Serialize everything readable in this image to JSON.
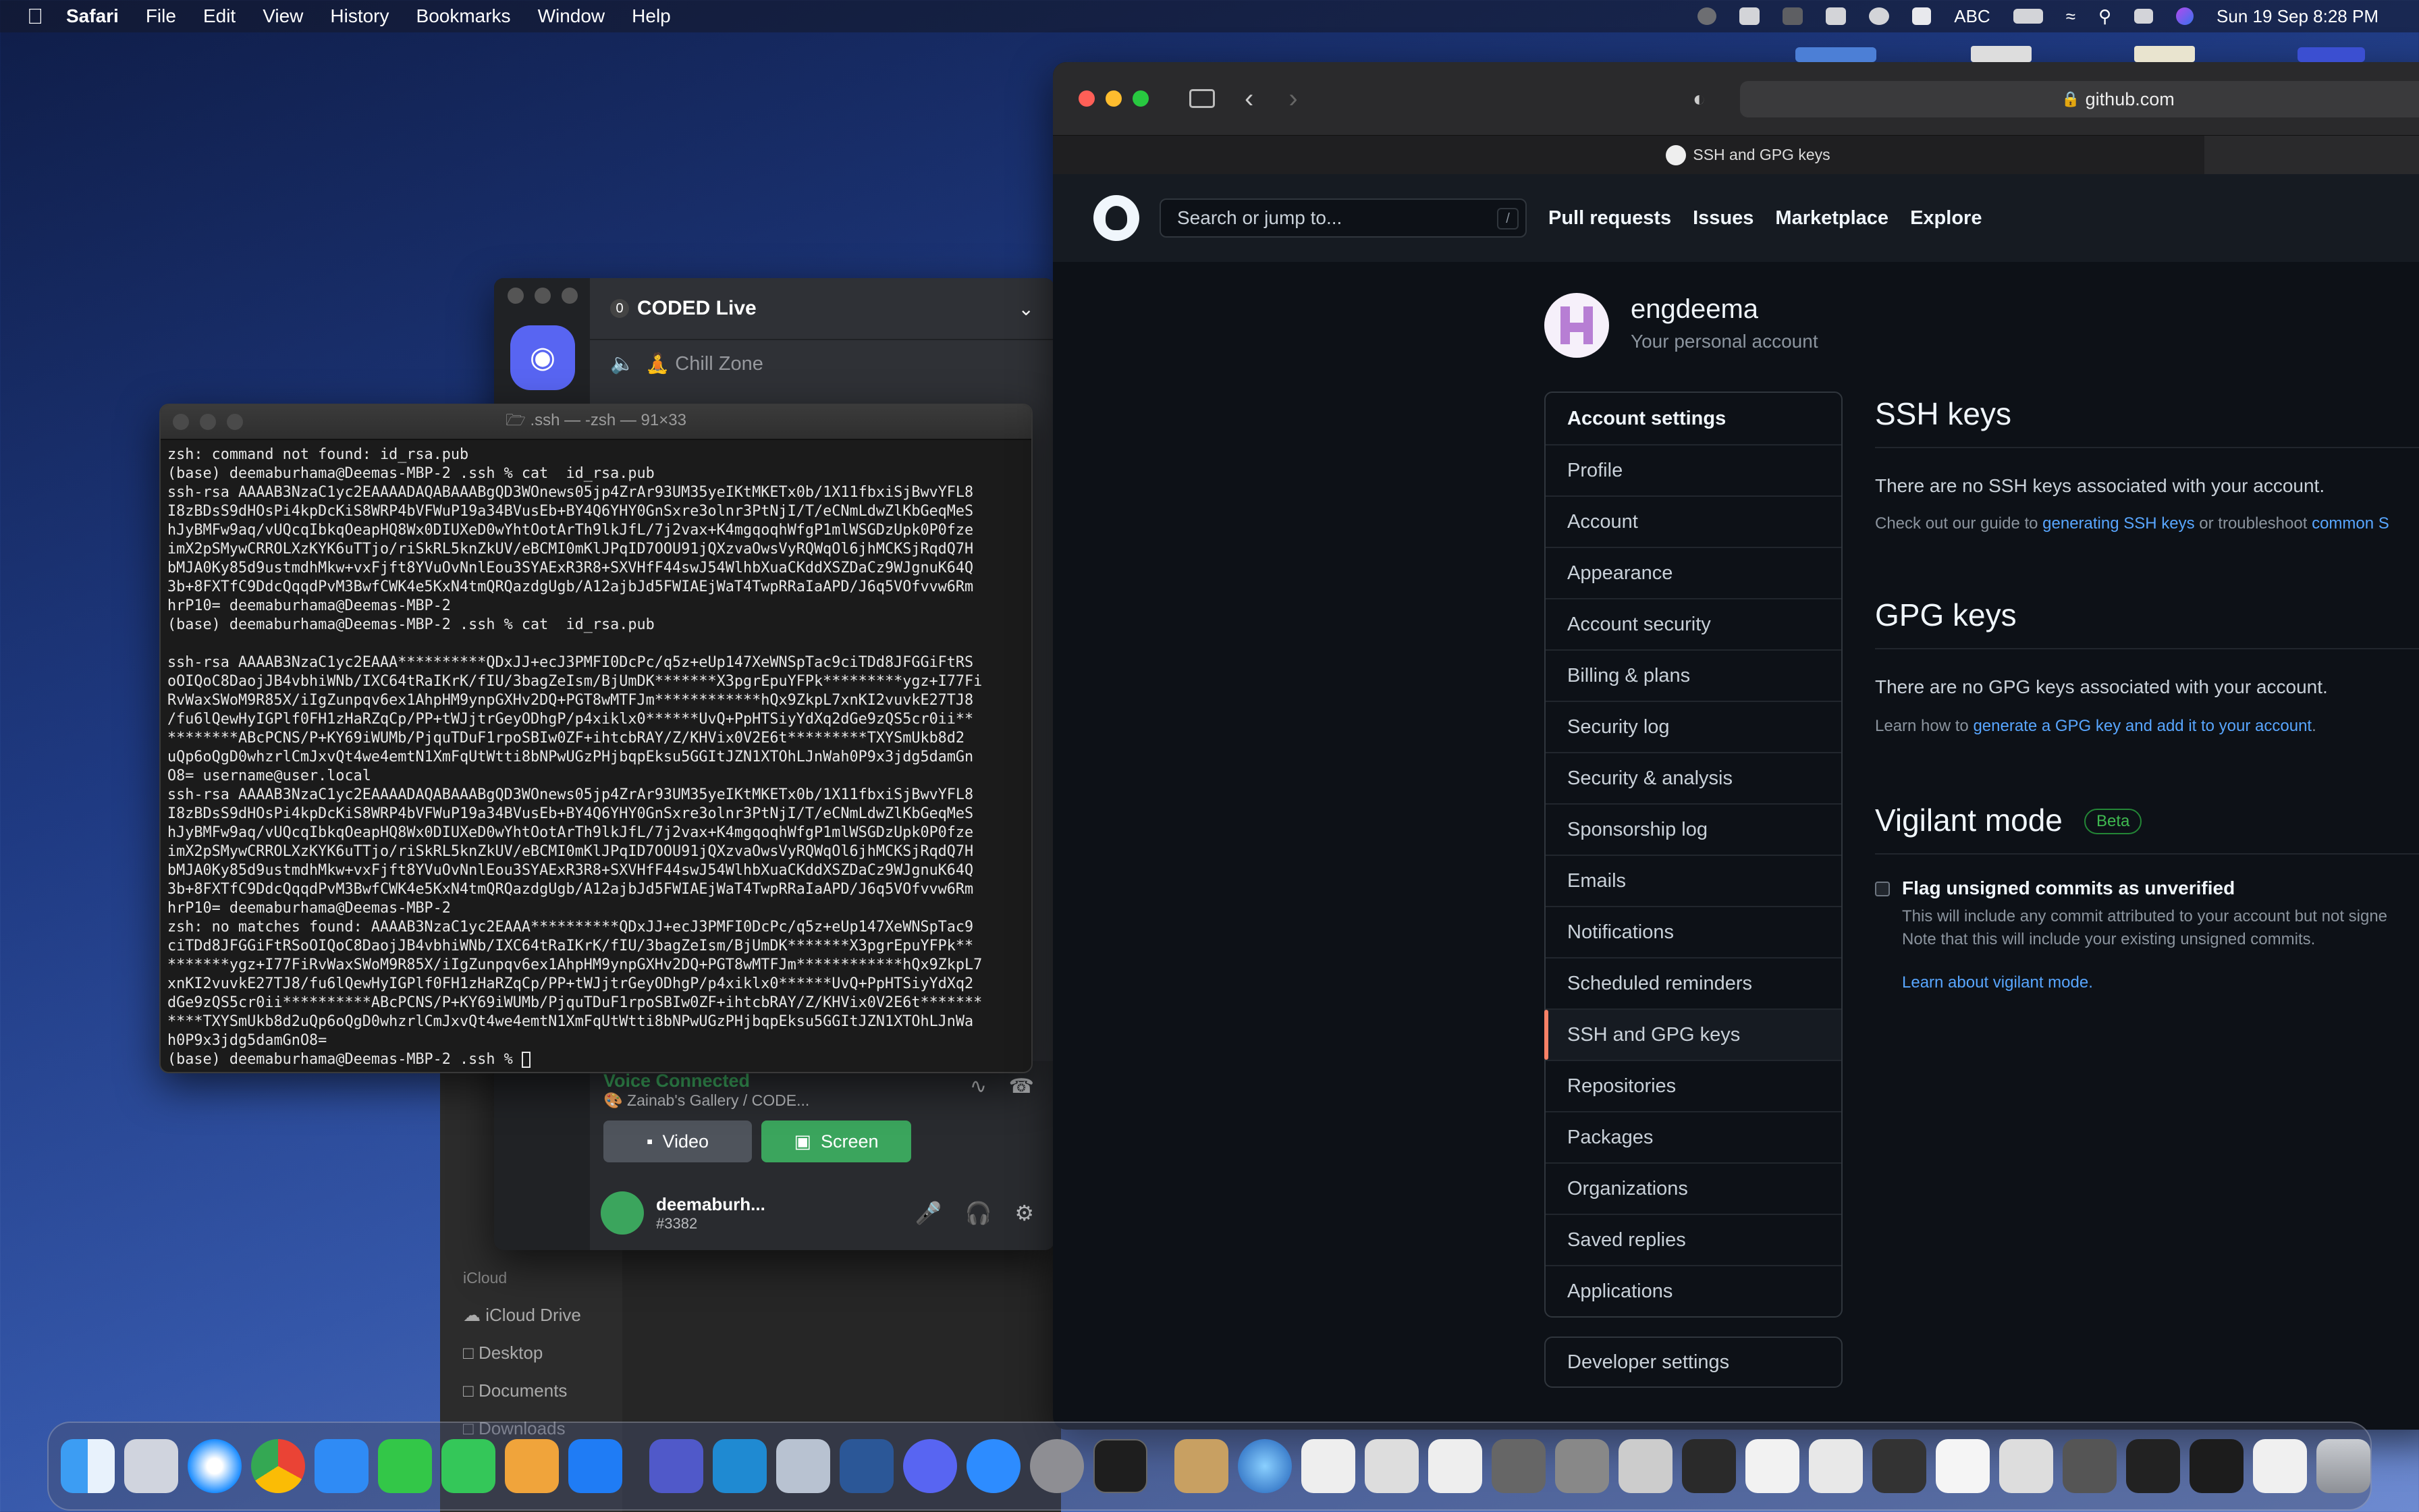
{
  "menubar": {
    "app_name": "Safari",
    "items": [
      "File",
      "Edit",
      "View",
      "History",
      "Bookmarks",
      "Window",
      "Help"
    ],
    "input_label": "ABC",
    "clock": "Sun 19 Sep  8:28 PM"
  },
  "discord": {
    "server_name": "CODED Live",
    "channel": "🧘 Chill Zone",
    "voice_status": "Voice Connected",
    "voice_channel": "🎨 Zainab's Gallery / CODE...",
    "video_label": "Video",
    "screen_label": "Screen",
    "username": "deemaburh...",
    "tag": "#3382"
  },
  "finder": {
    "section": "iCloud",
    "items": [
      "iCloud Drive",
      "Desktop",
      "Documents",
      "Downloads"
    ]
  },
  "terminal": {
    "title": ".ssh — -zsh — 91×33",
    "lines": [
      "zsh: command not found: id_rsa.pub",
      "(base) deemaburhama@Deemas-MBP-2 .ssh % cat  id_rsa.pub",
      "ssh-rsa AAAAB3NzaC1yc2EAAAADAQABAAABgQD3WOnews05jp4ZrAr93UM35yeIKtMKETx0b/1X11fbxiSjBwvYFL8",
      "I8zBDsS9dHOsPi4kpDcKiS8WRP4bVFWuP19a34BVusEb+BY4Q6YHY0GnSxre3olnr3PtNjI/T/eCNmLdwZlKbGeqMeS",
      "hJyBMFw9aq/vUQcqIbkqOeapHQ8Wx0DIUXeD0wYhtOotArTh9lkJfL/7j2vax+K4mgqoqhWfgP1mlWSGDzUpk0P0fze",
      "imX2pSMywCRROLXzKYK6uTTjo/riSkRL5knZkUV/eBCMI0mKlJPqID7OOU91jQXzvaOwsVyRQWqOl6jhMCKSjRqdQ7H",
      "bMJA0Ky85d9ustmdhMkw+vxFjft8YVuOvNnlEou3SYAExR3R8+SXVHfF44swJ54WlhbXuaCKddXSZDaCz9WJgnuK64Q",
      "3b+8FXTfC9DdcQqqdPvM3BwfCWK4e5KxN4tmQRQazdgUgb/A12ajbJd5FWIAEjWaT4TwpRRaIaAPD/J6q5VOfvvw6Rm",
      "hrP10= deemaburhama@Deemas-MBP-2",
      "(base) deemaburhama@Deemas-MBP-2 .ssh % cat  id_rsa.pub",
      "",
      "ssh-rsa AAAAB3NzaC1yc2EAAA**********QDxJJ+ecJ3PMFI0DcPc/q5z+eUp147XeWNSpTac9ciTDd8JFGGiFtRS",
      "oOIQoC8DaojJB4vbhiWNb/IXC64tRaIKrK/fIU/3bagZeIsm/BjUmDK*******X3pgrEpuYFPk*********ygz+I77Fi",
      "RvWaxSWoM9R85X/iIgZunpqv6ex1AhpHM9ynpGXHv2DQ+PGT8wMTFJm************hQx9ZkpL7xnKI2vuvkE27TJ8",
      "/fu6lQewHyIGPlf0FH1zHaRZqCp/PP+tWJjtrGeyODhgP/p4xiklx0******UvQ+PpHTSiyYdXq2dGe9zQS5cr0ii**",
      "********ABcPCNS/P+KY69iWUMb/PjquTDuF1rpoSBIw0ZF+ihtcbRAY/Z/KHVix0V2E6t*********TXYSmUkb8d2",
      "uQp6oQgD0whzrlCmJxvQt4we4emtN1XmFqUtWtti8bNPwUGzPHjbqpEksu5GGItJZN1XTOhLJnWah0P9x3jdg5damGn",
      "O8= username@user.local",
      "ssh-rsa AAAAB3NzaC1yc2EAAAADAQABAAABgQD3WOnews05jp4ZrAr93UM35yeIKtMKETx0b/1X11fbxiSjBwvYFL8",
      "I8zBDsS9dHOsPi4kpDcKiS8WRP4bVFWuP19a34BVusEb+BY4Q6YHY0GnSxre3olnr3PtNjI/T/eCNmLdwZlKbGeqMeS",
      "hJyBMFw9aq/vUQcqIbkqOeapHQ8Wx0DIUXeD0wYhtOotArTh9lkJfL/7j2vax+K4mgqoqhWfgP1mlWSGDzUpk0P0fze",
      "imX2pSMywCRROLXzKYK6uTTjo/riSkRL5knZkUV/eBCMI0mKlJPqID7OOU91jQXzvaOwsVyRQWqOl6jhMCKSjRqdQ7H",
      "bMJA0Ky85d9ustmdhMkw+vxFjft8YVuOvNnlEou3SYAExR3R8+SXVHfF44swJ54WlhbXuaCKddXSZDaCz9WJgnuK64Q",
      "3b+8FXTfC9DdcQqqdPvM3BwfCWK4e5KxN4tmQRQazdgUgb/A12ajbJd5FWIAEjWaT4TwpRRaIaAPD/J6q5VOfvvw6Rm",
      "hrP10= deemaburhama@Deemas-MBP-2",
      "zsh: no matches found: AAAAB3NzaC1yc2EAAA**********QDxJJ+ecJ3PMFI0DcPc/q5z+eUp147XeWNSpTac9",
      "ciTDd8JFGGiFtRSoOIQoC8DaojJB4vbhiWNb/IXC64tRaIKrK/fIU/3bagZeIsm/BjUmDK*******X3pgrEpuYFPk**",
      "*******ygz+I77FiRvWaxSWoM9R85X/iIgZunpqv6ex1AhpHM9ynpGXHv2DQ+PGT8wMTFJm************hQx9ZkpL7",
      "xnKI2vuvkE27TJ8/fu6lQewHyIGPlf0FH1zHaRZqCp/PP+tWJjtrGeyODhgP/p4xiklx0******UvQ+PpHTSiyYdXq2",
      "dGe9zQS5cr0ii**********ABcPCNS/P+KY69iWUMb/PjquTDuF1rpoSBIw0ZF+ihtcbRAY/Z/KHVix0V2E6t*******",
      "****TXYSmUkb8d2uQp6oQgD0whzrlCmJxvQt4we4emtN1XmFqUtWtti8bNPwUGzPHjbqpEksu5GGItJZN1XTOhLJnWa",
      "h0P9x3jdg5damGnO8=",
      "(base) deemaburhama@Deemas-MBP-2 .ssh % "
    ]
  },
  "safari": {
    "url": "github.com",
    "tab_title": "SSH and GPG keys"
  },
  "github": {
    "search_placeholder": "Search or jump to...",
    "search_shortcut": "/",
    "nav": [
      "Pull requests",
      "Issues",
      "Marketplace",
      "Explore"
    ],
    "username": "engdeema",
    "account_type": "Your personal account",
    "sidebar_header": "Account settings",
    "sidebar": [
      "Profile",
      "Account",
      "Appearance",
      "Account security",
      "Billing & plans",
      "Security log",
      "Security & analysis",
      "Sponsorship log",
      "Emails",
      "Notifications",
      "Scheduled reminders",
      "SSH and GPG keys",
      "Repositories",
      "Packages",
      "Organizations",
      "Saved replies",
      "Applications"
    ],
    "developer_settings": "Developer settings",
    "ssh": {
      "title": "SSH keys",
      "empty": "There are no SSH keys associated with your account.",
      "guide_prefix": "Check out our guide to ",
      "guide_link": "generating SSH keys",
      "guide_mid": " or troubleshoot ",
      "guide_link2": "common S"
    },
    "gpg": {
      "title": "GPG keys",
      "empty": "There are no GPG keys associated with your account.",
      "learn_prefix": "Learn how to ",
      "learn_link": "generate a GPG key and add it to your account",
      "learn_suffix": "."
    },
    "vigilant": {
      "title": "Vigilant mode",
      "badge": "Beta",
      "checkbox_label": "Flag unsigned commits as unverified",
      "desc1": "This will include any commit attributed to your account but not signe",
      "desc2": "Note that this will include your existing unsigned commits.",
      "learn": "Learn about vigilant mode."
    }
  },
  "dock": {
    "apps": [
      "finder-icon",
      "launchpad-icon",
      "safari-icon",
      "chrome-icon",
      "mail-icon",
      "facetime-icon",
      "messages-icon",
      "pages-icon",
      "app-store-icon",
      "teams-icon",
      "vscode-icon",
      "preview-icon",
      "word-icon",
      "discord-icon",
      "zoom-icon",
      "settings-icon",
      "terminal-icon"
    ],
    "colors": {
      "accent_green": "#3ba55d",
      "github_link": "#58a6ff",
      "github_selected_bar": "#f78166"
    }
  }
}
